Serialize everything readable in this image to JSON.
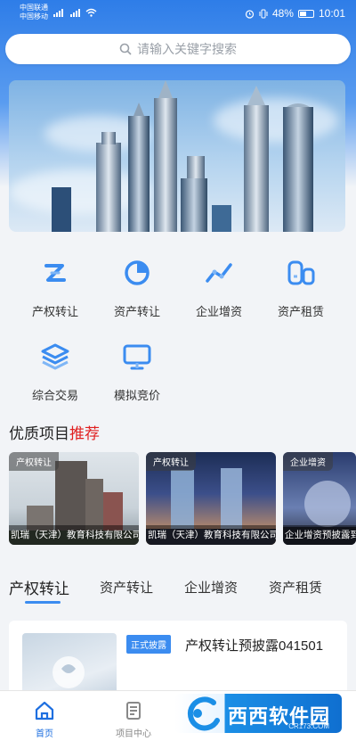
{
  "status": {
    "carrier1": "中国联通",
    "carrier2": "中国移动",
    "net1": "4G",
    "net2": "2G",
    "battery": "48%",
    "time": "10:01"
  },
  "search": {
    "placeholder": "请输入关键字搜索"
  },
  "grid": [
    {
      "label": "产权转让",
      "icon": "z-transfer-icon"
    },
    {
      "label": "资产转让",
      "icon": "pie-chart-icon"
    },
    {
      "label": "企业增资",
      "icon": "trend-line-icon"
    },
    {
      "label": "资产租赁",
      "icon": "building-icon"
    },
    {
      "label": "综合交易",
      "icon": "layers-icon"
    },
    {
      "label": "模拟竞价",
      "icon": "monitor-icon"
    }
  ],
  "featured": {
    "title_main": "优质项目",
    "title_highlight": "推荐",
    "cards": [
      {
        "tag": "产权转让",
        "caption": "凯瑞（天津）教育科技有限公司"
      },
      {
        "tag": "产权转让",
        "caption": "凯瑞（天津）教育科技有限公司"
      },
      {
        "tag": "企业增资",
        "caption": "企业增资预披露到"
      }
    ]
  },
  "tabs": [
    "产权转让",
    "资产转让",
    "企业增资",
    "资产租赁"
  ],
  "list": {
    "badge": "正式披露",
    "title": "产权转让预披露041501"
  },
  "nav": [
    {
      "label": "首页",
      "icon": "home-icon"
    },
    {
      "label": "项目中心",
      "icon": "document-icon"
    }
  ],
  "watermark": {
    "text": "西西软件园",
    "sub": "CR173.COM"
  },
  "colors": {
    "primary": "#2e7de8",
    "accent_red": "#e02020",
    "tab_underline": "#3b8cf0"
  }
}
